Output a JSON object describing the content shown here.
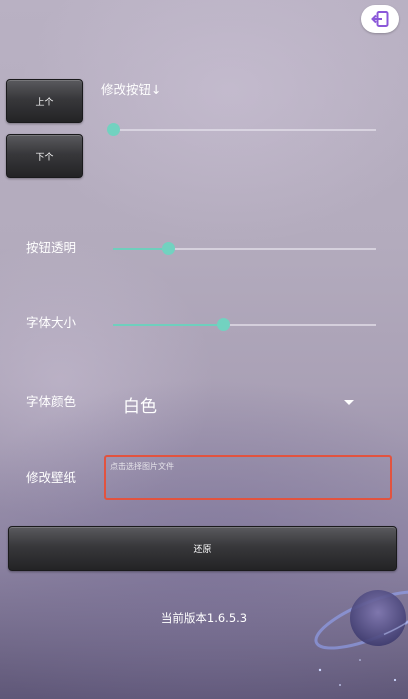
{
  "header": {
    "exit_icon": "exit-icon",
    "exit_color": "#8b58d9"
  },
  "buttons": {
    "prev_label": "上个",
    "next_label": "下个",
    "restore_label": "还原"
  },
  "settings": {
    "modify_button_label": "修改按钮↓",
    "modify_button_level": 0,
    "button_opacity_label": "按钮透明",
    "button_opacity_level": 0.21,
    "font_size_label": "字体大小",
    "font_size_level": 0.42,
    "font_color_label": "字体颜色",
    "font_color_value": "白色",
    "wallpaper_label": "修改壁纸",
    "wallpaper_placeholder": "点击选择图片文件"
  },
  "footer": {
    "version_text": "当前版本1.6.5.3"
  },
  "colors": {
    "slider_accent": "#6fcfbd",
    "file_box_border": "#e2533f"
  }
}
